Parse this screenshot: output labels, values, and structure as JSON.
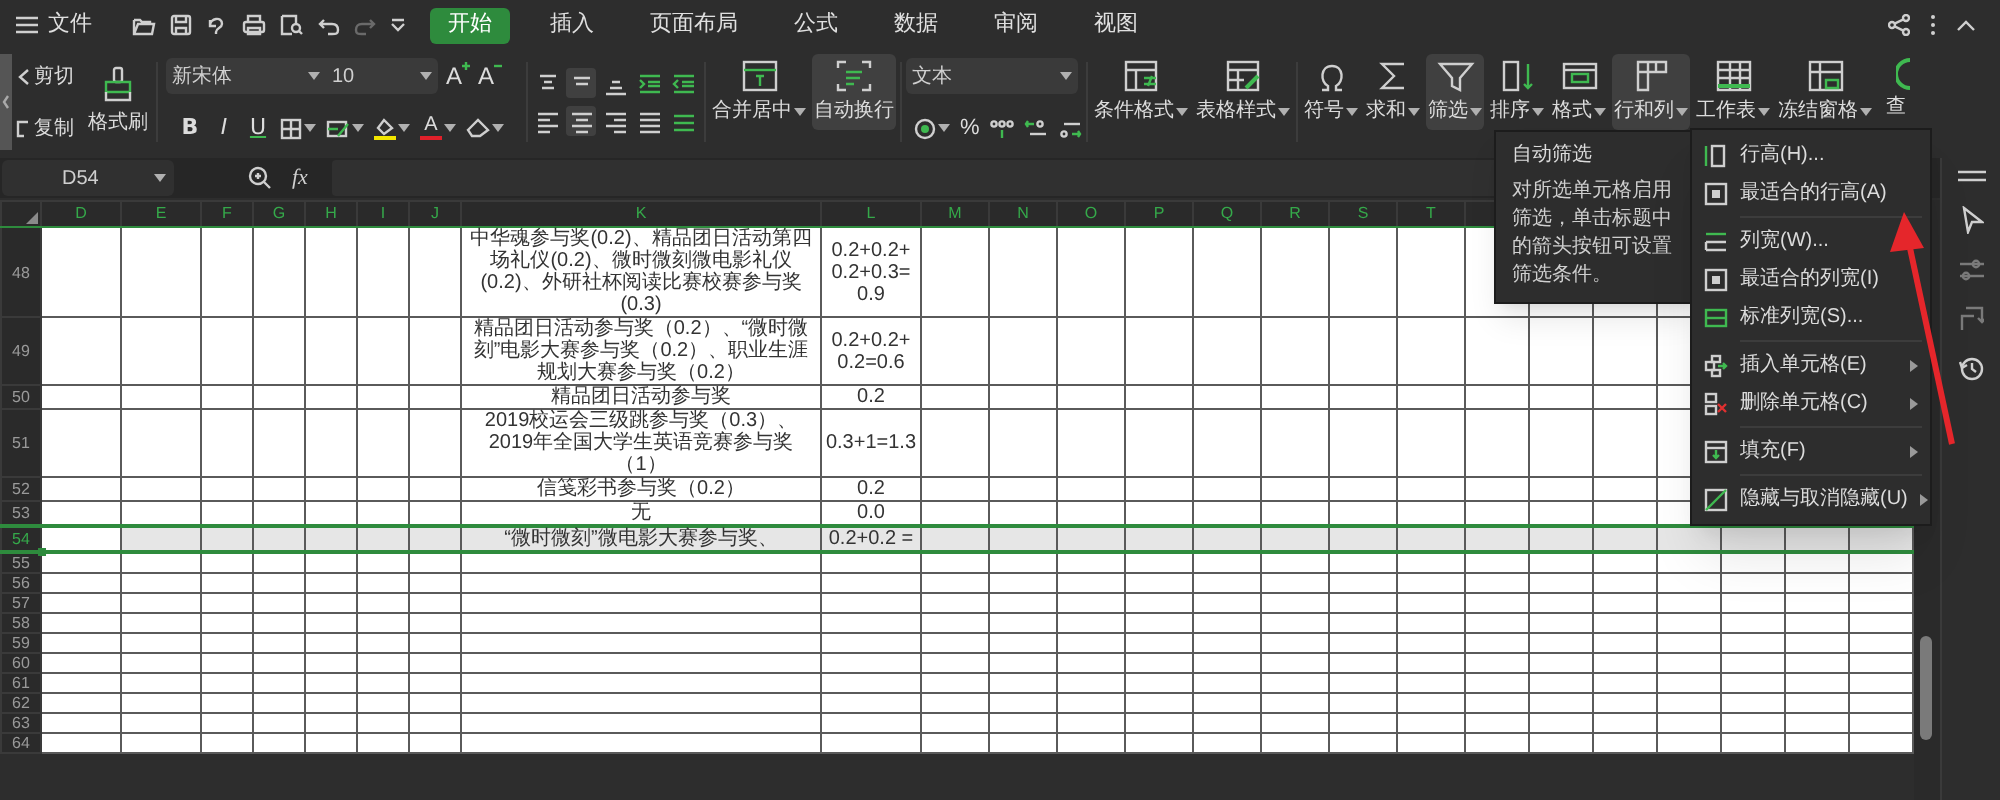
{
  "menubar": {
    "file": "文件",
    "tabs": [
      {
        "label": "开始",
        "selected": true
      },
      {
        "label": "插入",
        "selected": false
      },
      {
        "label": "页面布局",
        "selected": false
      },
      {
        "label": "公式",
        "selected": false
      },
      {
        "label": "数据",
        "selected": false
      },
      {
        "label": "审阅",
        "selected": false
      },
      {
        "label": "视图",
        "selected": false
      }
    ]
  },
  "ribbon": {
    "cut": "剪切",
    "copy": "复制",
    "format_painter": "格式刷",
    "font_name": "新宋体",
    "font_size": "10",
    "size_buttons": [
      "A",
      "A"
    ],
    "style_buttons": [
      "B",
      "I",
      "U"
    ],
    "font_color_glyph": "A",
    "align_buttons": [
      {
        "selected": false
      },
      {
        "selected": true
      },
      {
        "selected": false
      },
      {
        "selected": false
      },
      {
        "selected": false
      },
      {
        "selected": false
      },
      {
        "selected": true
      },
      {
        "selected": false
      },
      {
        "selected": false
      },
      {
        "selected": false
      }
    ],
    "layout_commands": [
      {
        "label": "合并居中",
        "dropdown": true,
        "highlighted": false
      },
      {
        "label": "自动换行",
        "dropdown": false,
        "highlighted": true
      }
    ],
    "number_format": "文本",
    "percent": "%",
    "style_commands": [
      {
        "label": "条件格式",
        "dropdown": true,
        "highlighted": false
      },
      {
        "label": "表格样式",
        "dropdown": true,
        "highlighted": false
      }
    ],
    "edit_commands": [
      {
        "label": "符号",
        "dropdown": true,
        "highlighted": false
      },
      {
        "label": "求和",
        "dropdown": true,
        "highlighted": false
      },
      {
        "label": "筛选",
        "dropdown": true,
        "highlighted": true
      },
      {
        "label": "排序",
        "dropdown": true,
        "highlighted": false
      },
      {
        "label": "格式",
        "dropdown": true,
        "highlighted": false
      },
      {
        "label": "行和列",
        "dropdown": true,
        "highlighted": true
      },
      {
        "label": "工作表",
        "dropdown": true,
        "highlighted": false
      },
      {
        "label": "冻结窗格",
        "dropdown": true,
        "highlighted": false
      },
      {
        "label": "查",
        "dropdown": false,
        "highlighted": false
      }
    ]
  },
  "formula_bar": {
    "name_box": "D54",
    "fx": "fx"
  },
  "sheet": {
    "columns": [
      "D",
      "E",
      "F",
      "G",
      "H",
      "I",
      "J",
      "K",
      "L",
      "M",
      "N",
      "O",
      "P",
      "Q",
      "R",
      "S",
      "T"
    ],
    "rows": [
      {
        "label": "48",
        "selected": false,
        "cells": [
          "中华魂参与奖(0.2)、精品团日活动第四场礼仪(0.2)、微时微刻微电影礼仪(0.2)、外研社杯阅读比赛校赛参与奖(0.3)",
          "0.2+0.2+0.2+0.3=0.9"
        ]
      },
      {
        "label": "49",
        "selected": false,
        "cells": [
          "精品团日活动参与奖（0.2）、“微时微刻”电影大赛参与奖（0.2）、职业生涯规划大赛参与奖（0.2）",
          "0.2+0.2+0.2=0.6"
        ]
      },
      {
        "label": "50",
        "selected": false,
        "cells": [
          "精品团日活动参与奖",
          "0.2"
        ]
      },
      {
        "label": "51",
        "selected": false,
        "cells": [
          "2019校运会三级跳参与奖（0.3）、2019年全国大学生英语竞赛参与奖（1）",
          "0.3+1=1.3"
        ]
      },
      {
        "label": "52",
        "selected": false,
        "cells": [
          "信笺彩书参与奖（0.2）",
          "0.2"
        ]
      },
      {
        "label": "53",
        "selected": false,
        "cells": [
          "无",
          "0.0"
        ]
      },
      {
        "label": "54",
        "selected": true,
        "cells": [
          "“微时微刻”微电影大赛参与奖、",
          "0.2+0.2 ="
        ]
      },
      {
        "label": "55",
        "selected": false
      },
      {
        "label": "56",
        "selected": false
      },
      {
        "label": "57",
        "selected": false
      },
      {
        "label": "58",
        "selected": false
      },
      {
        "label": "59",
        "selected": false
      },
      {
        "label": "60",
        "selected": false
      },
      {
        "label": "61",
        "selected": false
      },
      {
        "label": "62",
        "selected": false
      },
      {
        "label": "63",
        "selected": false
      },
      {
        "label": "64",
        "selected": false
      }
    ]
  },
  "tooltip": {
    "title": "自动筛选",
    "body": "对所选单元格启用筛选，单击标题中的箭头按钮可设置筛选条件。"
  },
  "menu": {
    "groups": [
      {
        "items": [
          {
            "label": "行高(H)...",
            "submenu": false
          },
          {
            "label": "最适合的行高(A)",
            "submenu": false
          }
        ]
      },
      {
        "items": [
          {
            "label": "列宽(W)...",
            "submenu": false
          },
          {
            "label": "最适合的列宽(I)",
            "submenu": false
          },
          {
            "label": "标准列宽(S)...",
            "submenu": false
          }
        ]
      },
      {
        "items": [
          {
            "label": "插入单元格(E)",
            "submenu": true
          },
          {
            "label": "删除单元格(C)",
            "submenu": true
          }
        ]
      },
      {
        "items": [
          {
            "label": "填充(F)",
            "submenu": true
          }
        ]
      },
      {
        "items": [
          {
            "label": "隐藏与取消隐藏(U)",
            "submenu": true
          }
        ]
      }
    ]
  }
}
